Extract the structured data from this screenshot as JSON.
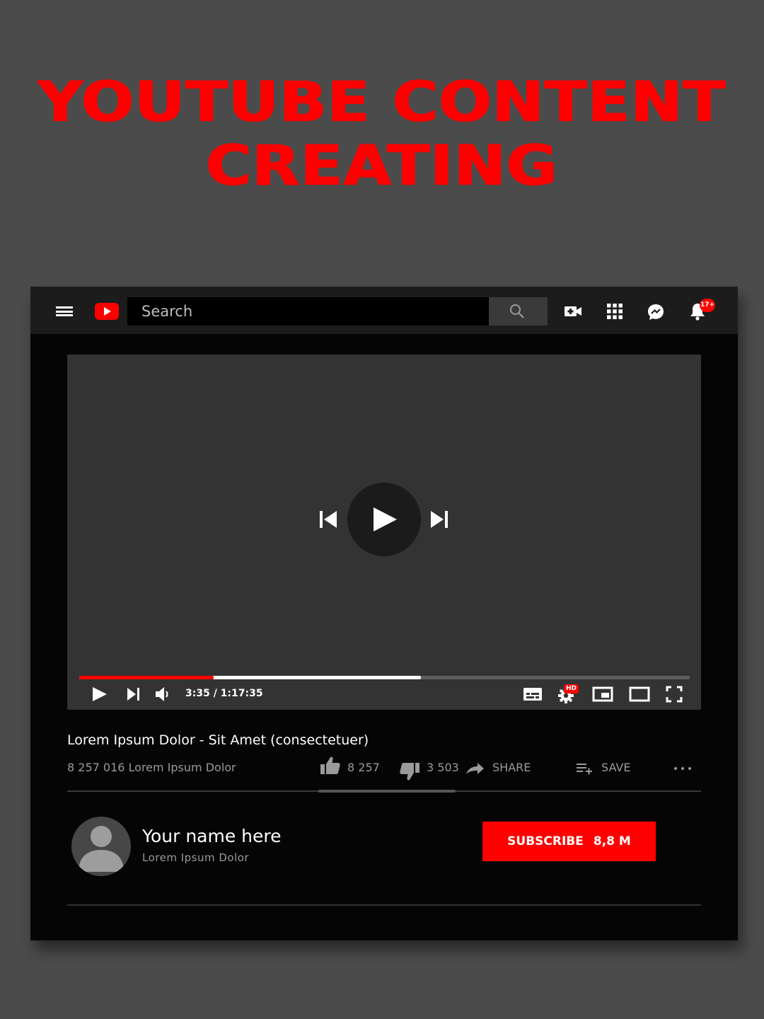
{
  "headline": {
    "line1": "YOUTUBE  CONTENT",
    "line2": "CREATING"
  },
  "topbar": {
    "search_placeholder": "Search",
    "notification_badge": "17+",
    "icons": [
      "menu-icon",
      "youtube-logo",
      "search-icon",
      "create-video-icon",
      "apps-grid-icon",
      "messages-icon",
      "notifications-bell-icon"
    ]
  },
  "player": {
    "time": "3:35 / 1:17:35",
    "played_fraction": 0.22,
    "buffered_fraction": 0.56,
    "settings_badge": "HD"
  },
  "video": {
    "title": "Lorem Ipsum Dolor - Sit Amet (consectetuer)",
    "views": "8 257 016 Lorem Ipsum Dolor",
    "likes": "8 257",
    "dislikes": "3 503",
    "share_label": "SHARE",
    "save_label": "SAVE"
  },
  "channel": {
    "name": "Your name here",
    "subtitle": "Lorem Ipsum Dolor",
    "subscribe_label": "SUBSCRIBE",
    "subscriber_count": "8,8 M"
  },
  "colors": {
    "accent": "#ff0000",
    "page_bg": "#4b4b4b",
    "window_bg": "#050505",
    "player_bg": "#333333"
  }
}
